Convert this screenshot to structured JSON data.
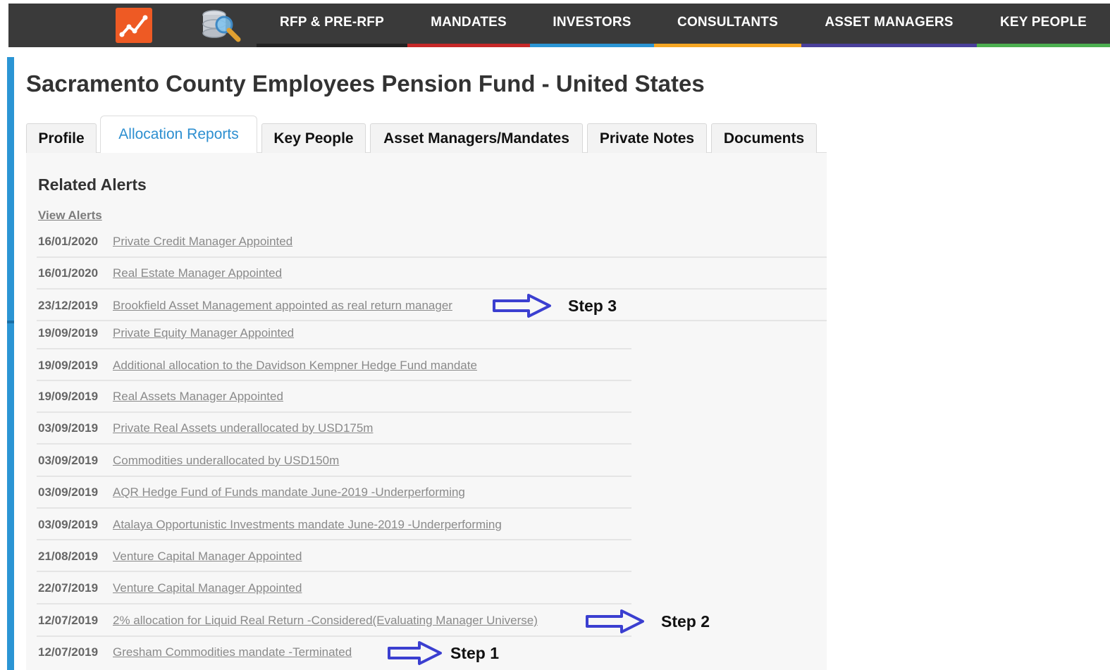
{
  "nav": {
    "items": [
      {
        "label": "RFP & PRE-RFP",
        "color": "#222222"
      },
      {
        "label": "MANDATES",
        "color": "#c62828"
      },
      {
        "label": "INVESTORS",
        "color": "#2b95d4"
      },
      {
        "label": "CONSULTANTS",
        "color": "#f5a623"
      },
      {
        "label": "ASSET MANAGERS",
        "color": "#4a3f9a"
      },
      {
        "label": "KEY PEOPLE",
        "color": "#4caf50"
      }
    ]
  },
  "page": {
    "title": "Sacramento County Employees Pension Fund - United States"
  },
  "tabs": [
    {
      "label": "Profile"
    },
    {
      "label": "Allocation Reports"
    },
    {
      "label": "Key People"
    },
    {
      "label": "Asset Managers/Mandates"
    },
    {
      "label": "Private Notes"
    },
    {
      "label": "Documents"
    }
  ],
  "active_tab": "Allocation Reports",
  "alerts": {
    "title": "Related Alerts",
    "view_link": "View Alerts",
    "items": [
      {
        "date": "16/01/2020",
        "text": "Private Credit Manager Appointed"
      },
      {
        "date": "16/01/2020",
        "text": "Real Estate Manager Appointed"
      },
      {
        "date": "23/12/2019",
        "text": "Brookfield Asset Management appointed as real return manager"
      },
      {
        "date": "19/09/2019",
        "text": "Private Equity Manager Appointed"
      },
      {
        "date": "19/09/2019",
        "text": "Additional allocation to the Davidson Kempner Hedge Fund mandate"
      },
      {
        "date": "19/09/2019",
        "text": "Real Assets Manager Appointed"
      },
      {
        "date": "03/09/2019",
        "text": "Private Real Assets underallocated by USD175m"
      },
      {
        "date": "03/09/2019",
        "text": "Commodities underallocated by USD150m"
      },
      {
        "date": "03/09/2019",
        "text": "AQR Hedge Fund of Funds mandate June-2019 -Underperforming"
      },
      {
        "date": "03/09/2019",
        "text": "Atalaya Opportunistic Investments mandate June-2019 -Underperforming"
      },
      {
        "date": "21/08/2019",
        "text": "Venture Capital Manager Appointed"
      },
      {
        "date": "22/07/2019",
        "text": "Venture Capital Manager Appointed"
      },
      {
        "date": "12/07/2019",
        "text": "2% allocation for Liquid Real Return -Considered(Evaluating Manager Universe)"
      },
      {
        "date": "12/07/2019",
        "text": "Gresham Commodities mandate -Terminated"
      }
    ]
  },
  "annotations": {
    "step3": "Step 3",
    "step2": "Step 2",
    "step1": "Step 1"
  },
  "colors": {
    "accent": "#2b95d4",
    "arrow": "#3b3fd0",
    "nav_bg": "#3a3a3a",
    "logo": "#ee5a24"
  }
}
